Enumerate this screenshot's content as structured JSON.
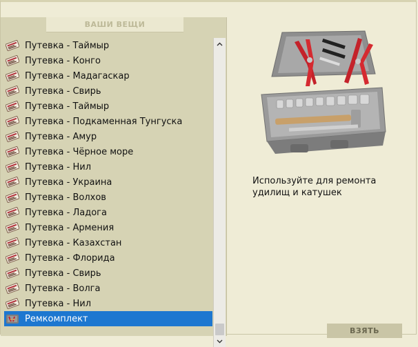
{
  "inventory": {
    "title": "ВАШИ ВЕЩИ",
    "items": [
      {
        "label": "Путевка - Таймыр",
        "icon": "ticket-icon"
      },
      {
        "label": "Путевка - Конго",
        "icon": "ticket-icon"
      },
      {
        "label": "Путевка - Мадагаскар",
        "icon": "ticket-icon"
      },
      {
        "label": "Путевка - Свирь",
        "icon": "ticket-icon"
      },
      {
        "label": "Путевка - Таймыр",
        "icon": "ticket-icon"
      },
      {
        "label": "Путевка - Подкаменная Тунгуска",
        "icon": "ticket-icon"
      },
      {
        "label": "Путевка - Амур",
        "icon": "ticket-icon"
      },
      {
        "label": "Путевка - Чёрное море",
        "icon": "ticket-icon"
      },
      {
        "label": "Путевка - Нил",
        "icon": "ticket-icon"
      },
      {
        "label": "Путевка - Украина",
        "icon": "ticket-icon"
      },
      {
        "label": "Путевка - Волхов",
        "icon": "ticket-icon"
      },
      {
        "label": "Путевка - Ладога",
        "icon": "ticket-icon"
      },
      {
        "label": "Путевка - Армения",
        "icon": "ticket-icon"
      },
      {
        "label": "Путевка - Казахстан",
        "icon": "ticket-icon"
      },
      {
        "label": "Путевка - Флорида",
        "icon": "ticket-icon"
      },
      {
        "label": "Путевка - Свирь",
        "icon": "ticket-icon"
      },
      {
        "label": "Путевка - Волга",
        "icon": "ticket-icon"
      },
      {
        "label": "Путевка - Нил",
        "icon": "ticket-icon"
      },
      {
        "label": "Ремкомплект",
        "icon": "repair-kit-icon",
        "selected": true
      }
    ]
  },
  "detail": {
    "image": "toolbox-image",
    "description": "Используйте для ремонта удилищ и катушек",
    "take_label": "ВЗЯТЬ"
  },
  "colors": {
    "selection": "#1d77d0",
    "panel": "#d6d3b4",
    "background": "#efecd6"
  }
}
